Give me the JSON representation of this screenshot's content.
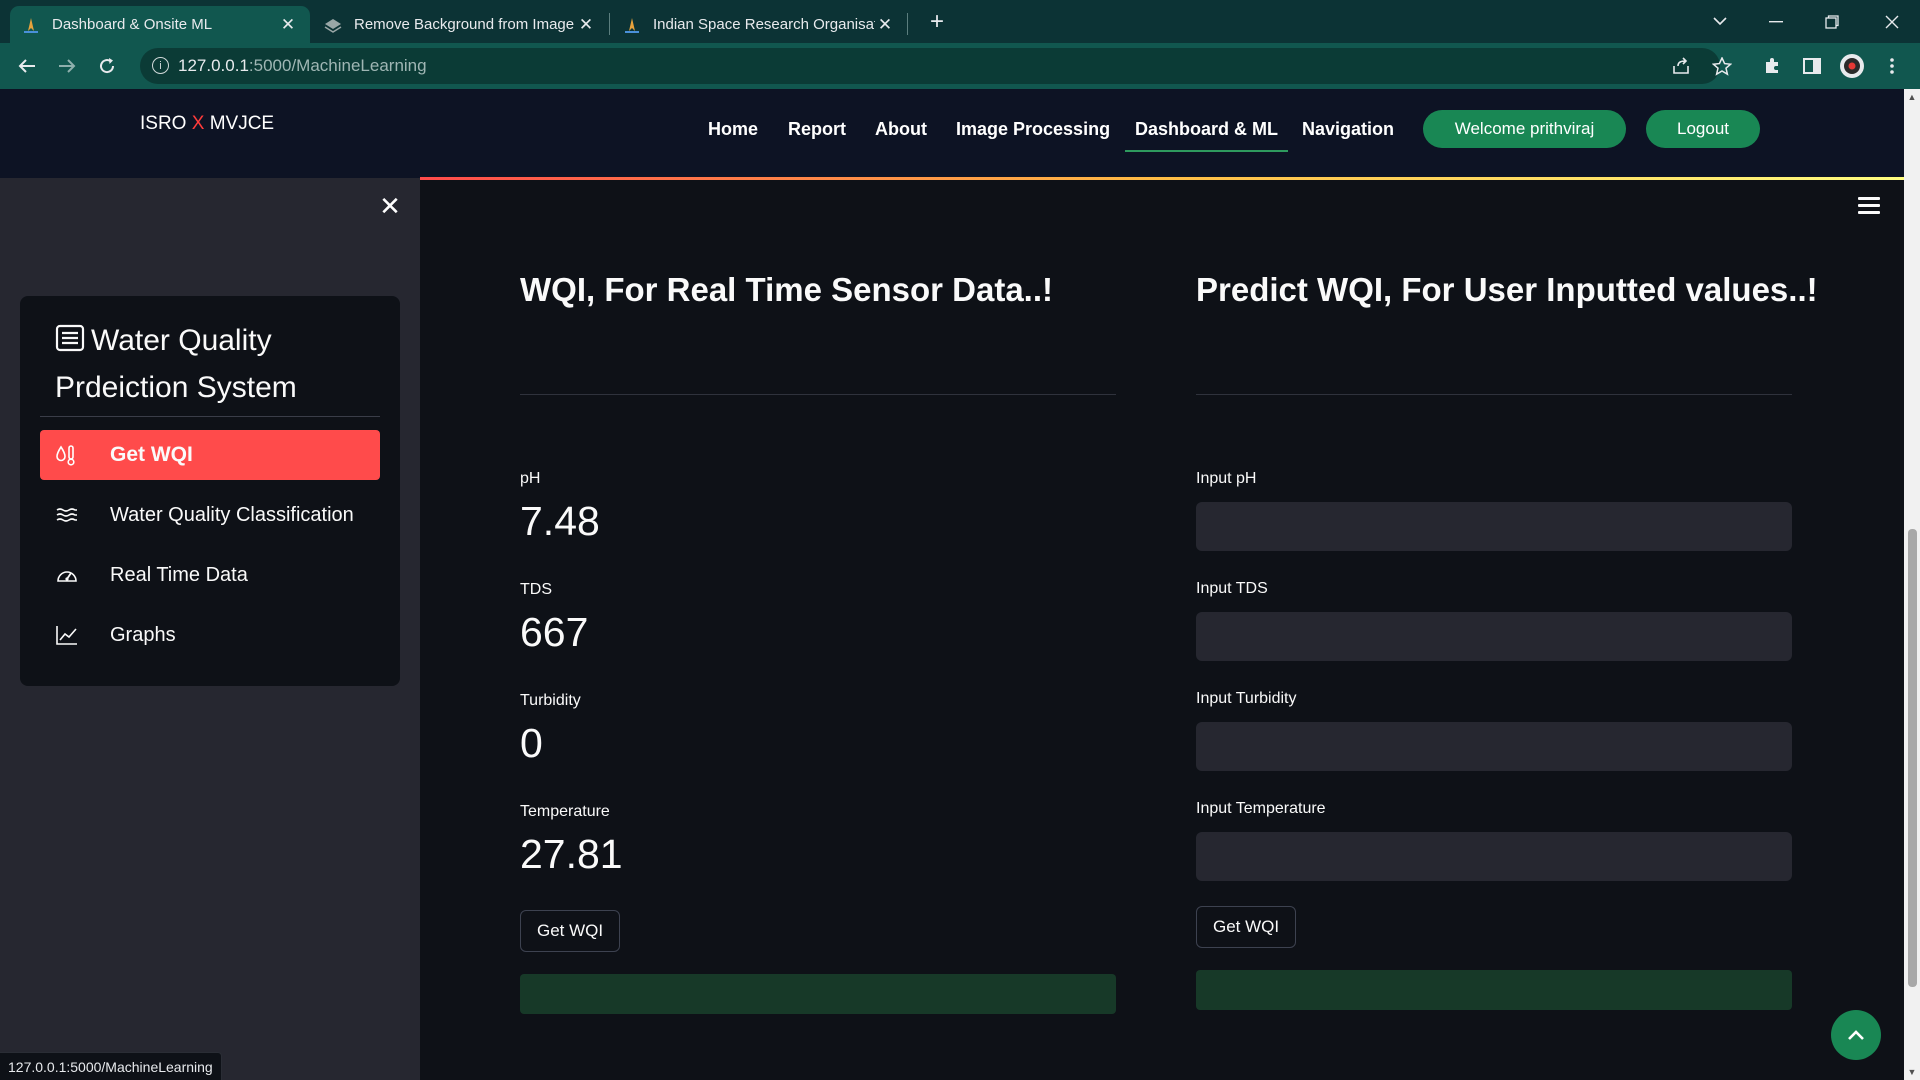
{
  "browser": {
    "tabs": [
      {
        "title": "Dashboard & Onsite ML",
        "active": true
      },
      {
        "title": "Remove Background from Image",
        "active": false
      },
      {
        "title": "Indian Space Research Organisati",
        "active": false
      }
    ],
    "url_host": "127.0.0.1",
    "url_path": ":5000/MachineLearning",
    "status_text": "127.0.0.1:5000/MachineLearning"
  },
  "navbar": {
    "brand_left": "ISRO",
    "brand_x": "X",
    "brand_right": "MVJCE",
    "links": [
      "Home",
      "Report",
      "About",
      "Image Processing",
      "Dashboard & ML",
      "Navigation"
    ],
    "active_link": "Dashboard & ML",
    "welcome": "Welcome prithviraj",
    "logout": "Logout"
  },
  "sidebar": {
    "title": "Water Quality Prdeiction System",
    "items": [
      {
        "label": "Get WQI",
        "icon": "droplet-thermometer-icon",
        "active": true
      },
      {
        "label": "Water Quality Classification",
        "icon": "waves-icon",
        "active": false
      },
      {
        "label": "Real Time Data",
        "icon": "speedometer-icon",
        "active": false
      },
      {
        "label": "Graphs",
        "icon": "line-chart-icon",
        "active": false
      }
    ]
  },
  "realtime": {
    "heading": "WQI, For Real Time Sensor Data..!",
    "metrics": [
      {
        "label": "pH",
        "value": "7.48"
      },
      {
        "label": "TDS",
        "value": "667"
      },
      {
        "label": "Turbidity",
        "value": "0"
      },
      {
        "label": "Temperature",
        "value": "27.81"
      }
    ],
    "button": "Get WQI"
  },
  "predict": {
    "heading": "Predict WQI, For User Inputted values..!",
    "inputs": [
      {
        "label": "Input pH",
        "value": ""
      },
      {
        "label": "Input TDS",
        "value": ""
      },
      {
        "label": "Input Turbidity",
        "value": ""
      },
      {
        "label": "Input Temperature",
        "value": ""
      }
    ],
    "button": "Get WQI"
  },
  "colors": {
    "accent_red": "#ff4b4b",
    "nav_green": "#198754",
    "result_green": "#173928",
    "background": "#0e1117"
  }
}
